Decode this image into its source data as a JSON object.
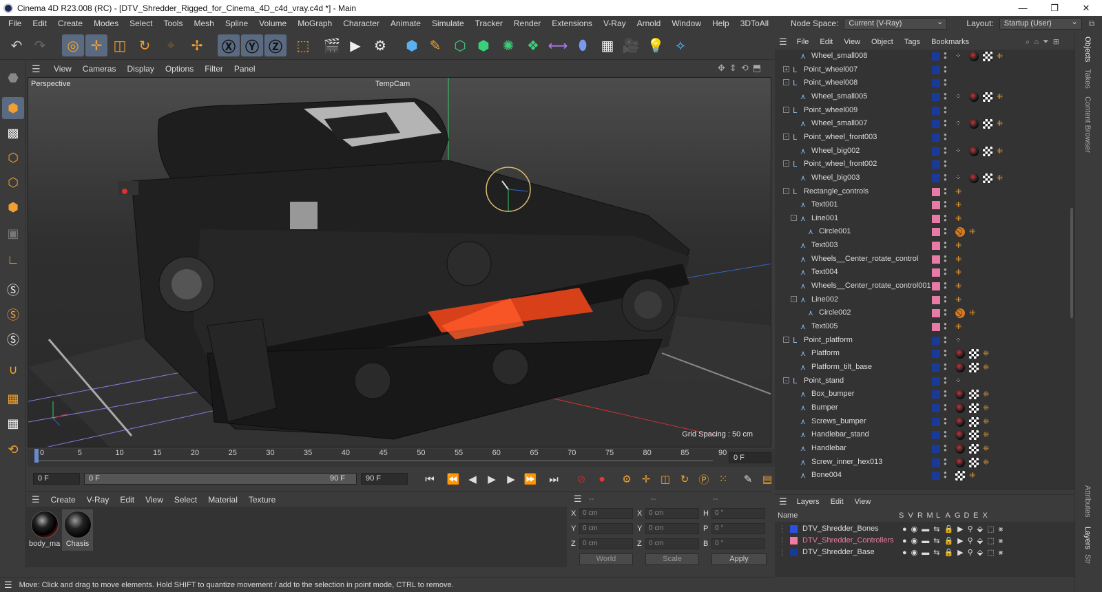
{
  "window": {
    "title": "Cinema 4D R23.008 (RC) - [DTV_Shredder_Rigged_for_Cinema_4D_c4d_vray.c4d *] - Main",
    "minimize": "—",
    "maximize": "❐",
    "close": "✕"
  },
  "menu": [
    "File",
    "Edit",
    "Create",
    "Modes",
    "Select",
    "Tools",
    "Mesh",
    "Spline",
    "Volume",
    "MoGraph",
    "Character",
    "Animate",
    "Simulate",
    "Tracker",
    "Render",
    "Extensions",
    "V-Ray",
    "Arnold",
    "Window",
    "Help",
    "3DToAll"
  ],
  "node_space": {
    "label": "Node Space:",
    "value": "Current (V-Ray)"
  },
  "layout": {
    "label": "Layout:",
    "value": "Startup (User)"
  },
  "viewport": {
    "menu": [
      "View",
      "Cameras",
      "Display",
      "Options",
      "Filter",
      "Panel"
    ],
    "label": "Perspective",
    "camera": "TempCam",
    "grid_spacing": "Grid Spacing : 50 cm"
  },
  "timeline": {
    "ticks": [
      "0",
      "5",
      "10",
      "15",
      "20",
      "25",
      "30",
      "35",
      "40",
      "45",
      "50",
      "55",
      "60",
      "65",
      "70",
      "75",
      "80",
      "85",
      "90"
    ],
    "current_frame": "0 F",
    "start": "0 F",
    "range_start": "0 F",
    "range_end": "90 F",
    "end": "90 F"
  },
  "material_menu": [
    "Create",
    "V-Ray",
    "Edit",
    "View",
    "Select",
    "Material",
    "Texture"
  ],
  "materials": [
    {
      "name": "body_ma"
    },
    {
      "name": "Chasis"
    }
  ],
  "coords": {
    "header_dashes": [
      "--",
      "--",
      "--"
    ],
    "rows": [
      {
        "a": "X",
        "av": "0 cm",
        "b": "X",
        "bv": "0 cm",
        "c": "H",
        "cv": "0 °"
      },
      {
        "a": "Y",
        "av": "0 cm",
        "b": "Y",
        "bv": "0 cm",
        "c": "P",
        "cv": "0 °"
      },
      {
        "a": "Z",
        "av": "0 cm",
        "b": "Z",
        "bv": "0 cm",
        "c": "B",
        "cv": "0 °"
      }
    ],
    "space": "World",
    "mode": "Scale",
    "apply": "Apply"
  },
  "status": "Move: Click and drag to move elements. Hold SHIFT to quantize movement / add to the selection in point mode, CTRL to remove.",
  "object_menu": [
    "File",
    "Edit",
    "View",
    "Object",
    "Tags",
    "Bookmarks"
  ],
  "objects": [
    {
      "name": "Wheel_small008",
      "depth": 1,
      "exp": "",
      "layer": "#1a3a9a",
      "tags": [
        "bone",
        "mat",
        "chk",
        "ik"
      ]
    },
    {
      "name": "Point_wheel007",
      "depth": 0,
      "exp": "+",
      "layer": "#1a3a9a",
      "tags": []
    },
    {
      "name": "Point_wheel008",
      "depth": 0,
      "exp": "-",
      "layer": "#1a3a9a",
      "tags": []
    },
    {
      "name": "Wheel_small005",
      "depth": 1,
      "exp": "",
      "layer": "#1a3a9a",
      "tags": [
        "bone",
        "mat",
        "chk",
        "ik"
      ]
    },
    {
      "name": "Point_wheel009",
      "depth": 0,
      "exp": "-",
      "layer": "#1a3a9a",
      "tags": []
    },
    {
      "name": "Wheel_small007",
      "depth": 1,
      "exp": "",
      "layer": "#1a3a9a",
      "tags": [
        "bone",
        "mat",
        "chk",
        "ik"
      ]
    },
    {
      "name": "Point_wheel_front003",
      "depth": 0,
      "exp": "-",
      "layer": "#1a3a9a",
      "tags": []
    },
    {
      "name": "Wheel_big002",
      "depth": 1,
      "exp": "",
      "layer": "#1a3a9a",
      "tags": [
        "bone",
        "mat",
        "chk",
        "ik"
      ]
    },
    {
      "name": "Point_wheel_front002",
      "depth": 0,
      "exp": "-",
      "layer": "#1a3a9a",
      "tags": []
    },
    {
      "name": "Wheel_big003",
      "depth": 1,
      "exp": "",
      "layer": "#1a3a9a",
      "tags": [
        "bone",
        "mat",
        "chk",
        "ik"
      ]
    },
    {
      "name": "Rectangle_controls",
      "depth": 0,
      "exp": "-",
      "layer": "#e87aa8",
      "tags": [
        "ik"
      ]
    },
    {
      "name": "Text001",
      "depth": 1,
      "exp": "",
      "layer": "#e87aa8",
      "tags": [
        "ik"
      ]
    },
    {
      "name": "Line001",
      "depth": 1,
      "exp": "-",
      "layer": "#e87aa8",
      "tags": [
        "ik"
      ]
    },
    {
      "name": "Circle001",
      "depth": 2,
      "exp": "",
      "layer": "#e87aa8",
      "tags": [
        "no",
        "ik"
      ]
    },
    {
      "name": "Text003",
      "depth": 1,
      "exp": "",
      "layer": "#e87aa8",
      "tags": [
        "ik"
      ]
    },
    {
      "name": "Wheels__Center_rotate_control",
      "depth": 1,
      "exp": "",
      "layer": "#e87aa8",
      "tags": [
        "ik"
      ]
    },
    {
      "name": "Text004",
      "depth": 1,
      "exp": "",
      "layer": "#e87aa8",
      "tags": [
        "ik"
      ]
    },
    {
      "name": "Wheels__Center_rotate_control001",
      "depth": 1,
      "exp": "",
      "layer": "#e87aa8",
      "tags": [
        "ik"
      ]
    },
    {
      "name": "Line002",
      "depth": 1,
      "exp": "-",
      "layer": "#e87aa8",
      "tags": [
        "ik"
      ]
    },
    {
      "name": "Circle002",
      "depth": 2,
      "exp": "",
      "layer": "#e87aa8",
      "tags": [
        "no",
        "ik"
      ]
    },
    {
      "name": "Text005",
      "depth": 1,
      "exp": "",
      "layer": "#e87aa8",
      "tags": [
        "ik"
      ]
    },
    {
      "name": "Point_platform",
      "depth": 0,
      "exp": "-",
      "layer": "#1a3a9a",
      "tags": [
        "bone"
      ]
    },
    {
      "name": "Platform",
      "depth": 1,
      "exp": "",
      "layer": "#1a3a9a",
      "tags": [
        "mat",
        "chk",
        "ik"
      ]
    },
    {
      "name": "Platform_tilt_base",
      "depth": 1,
      "exp": "",
      "layer": "#1a3a9a",
      "tags": [
        "mat",
        "chk",
        "ik"
      ]
    },
    {
      "name": "Point_stand",
      "depth": 0,
      "exp": "-",
      "layer": "#1a3a9a",
      "tags": [
        "bone"
      ]
    },
    {
      "name": "Box_bumper",
      "depth": 1,
      "exp": "",
      "layer": "#1a3a9a",
      "tags": [
        "mat",
        "chk",
        "ik"
      ]
    },
    {
      "name": "Bumper",
      "depth": 1,
      "exp": "",
      "layer": "#1a3a9a",
      "tags": [
        "mat",
        "chk",
        "ik"
      ]
    },
    {
      "name": "Screws_bumper",
      "depth": 1,
      "exp": "",
      "layer": "#1a3a9a",
      "tags": [
        "mat",
        "chk",
        "ik"
      ]
    },
    {
      "name": "Handlebar_stand",
      "depth": 1,
      "exp": "",
      "layer": "#1a3a9a",
      "tags": [
        "mat",
        "chk",
        "ik"
      ]
    },
    {
      "name": "Handlebar",
      "depth": 1,
      "exp": "",
      "layer": "#1a3a9a",
      "tags": [
        "mat",
        "chk",
        "ik"
      ]
    },
    {
      "name": "Screw_inner_hex013",
      "depth": 1,
      "exp": "",
      "layer": "#1a3a9a",
      "tags": [
        "mat",
        "chk",
        "ik"
      ]
    },
    {
      "name": "Bone004",
      "depth": 1,
      "exp": "",
      "layer": "#1a3a9a",
      "tags": [
        "chk",
        "ik"
      ]
    }
  ],
  "layer_menu": [
    "Layers",
    "Edit",
    "View"
  ],
  "layer_columns": {
    "name": "Name",
    "flags": [
      "S",
      "V",
      "R",
      "M",
      "L",
      "A",
      "G",
      "D",
      "E",
      "X"
    ]
  },
  "layers": [
    {
      "name": "DTV_Shredder_Bones",
      "color": "#2c4fe0",
      "text_color": "#dcdcdc"
    },
    {
      "name": "DTV_Shredder_Controllers",
      "color": "#f07aa8",
      "text_color": "#f07aa8"
    },
    {
      "name": "DTV_Shredder_Base",
      "color": "#1a3a9a",
      "text_color": "#dcdcdc"
    }
  ],
  "side_tabs": [
    "Objects",
    "Takes",
    "Content Browser",
    "Attributes",
    "Layers",
    "Str"
  ]
}
